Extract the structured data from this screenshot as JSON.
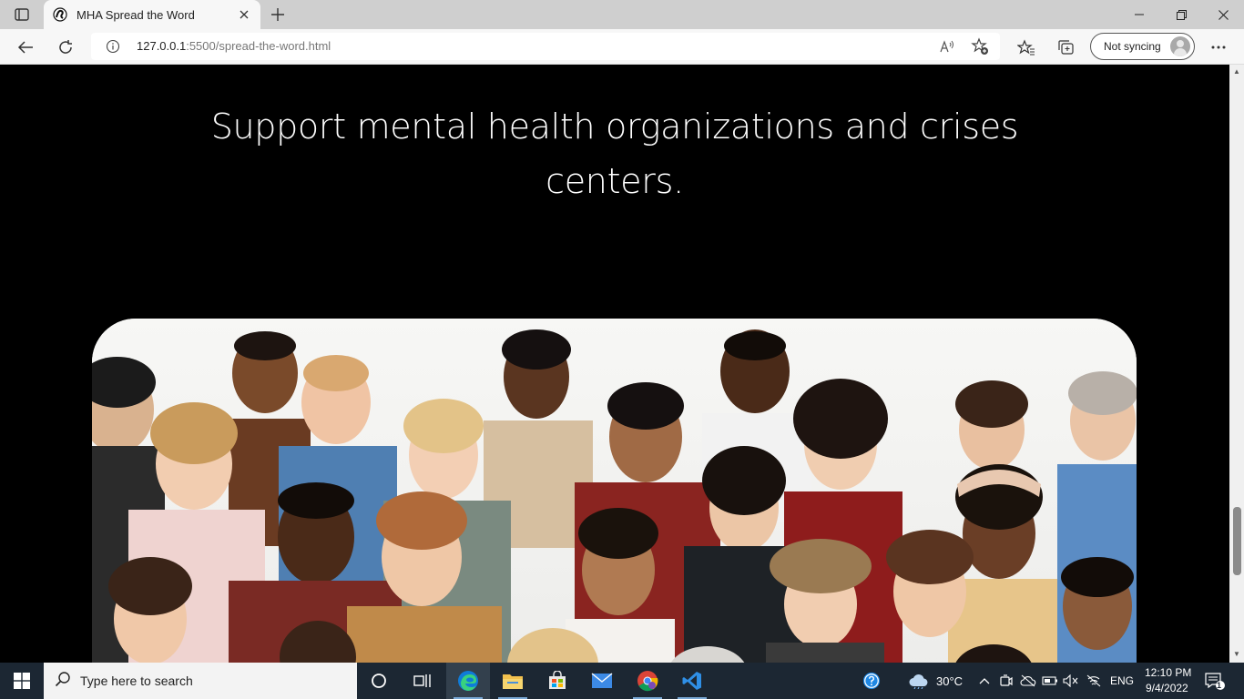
{
  "browser": {
    "tab": {
      "title": "MHA Spread the Word"
    },
    "address": {
      "host": "127.0.0.1",
      "path": ":5500/spread-the-word.html"
    },
    "sync_label": "Not syncing"
  },
  "page": {
    "headline_line1": "Support mental health organizations and crises",
    "headline_line2": "centers."
  },
  "taskbar": {
    "search_placeholder": "Type here to search",
    "weather": "30°C",
    "language": "ENG",
    "time": "12:10 PM",
    "date": "9/4/2022",
    "notification_count": "1"
  },
  "colors": {
    "page_background": "#000000",
    "taskbar": "#1c2733",
    "edge_accent": "#0f7bd8"
  }
}
